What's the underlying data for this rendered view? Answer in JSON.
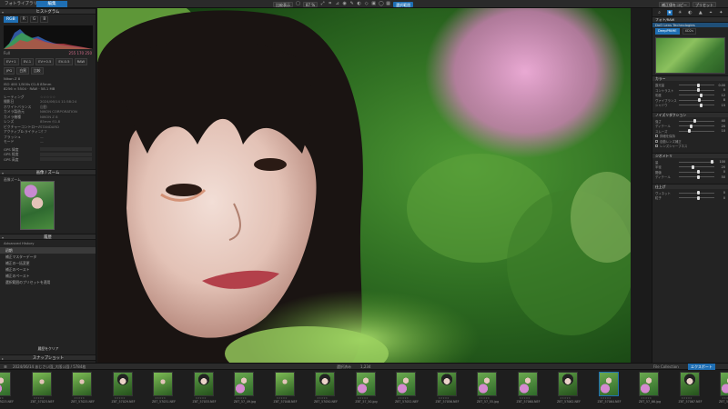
{
  "topbar": {
    "tabs": [
      "フォトライブラリ",
      "編集"
    ],
    "center_buttons": [
      "比較表示",
      "87 %",
      "選択範囲"
    ],
    "right_buttons": [
      "補正値をコピー",
      "プリセット"
    ]
  },
  "left_panel": {
    "histogram": {
      "title": "ヒストグラム",
      "tabs": [
        "RGB",
        "R",
        "G",
        "B"
      ],
      "values": "255  170  250",
      "mode": "Full"
    },
    "ev_buttons": [
      "EV+1",
      "EV-1",
      "EV+0.5",
      "EV-0.5",
      "RAW",
      "JPG",
      "白黒",
      "比較"
    ],
    "info_lines": [
      "Nikon Z 8",
      "ISO 400  1/500s  f/1.8  85mm",
      "8256 × 5504  ·  RAW  ·  58.1 MB"
    ],
    "meta_rows": [
      {
        "k": "レーティング",
        "v": "☆☆☆☆☆"
      },
      {
        "k": "撮影日",
        "v": "2024/06/14  11:58:24"
      },
      {
        "k": "ホワイトバランス",
        "v": "自動"
      },
      {
        "k": "カメラ製造元",
        "v": "NIKON CORPORATION"
      },
      {
        "k": "カメラ機種",
        "v": "NIKON Z 8"
      },
      {
        "k": "レンズ",
        "v": "85mm f/1.8"
      },
      {
        "k": "ピクチャーコントロール",
        "v": "STANDARD"
      },
      {
        "k": "アクティブD-ライティング",
        "v": "オフ"
      },
      {
        "k": "フラッシュ",
        "v": "—"
      },
      {
        "k": "モード",
        "v": "—"
      }
    ],
    "gps_rows": [
      {
        "k": "GPS 緯度",
        "v": ""
      },
      {
        "k": "GPS 経度",
        "v": ""
      },
      {
        "k": "GPS 高度",
        "v": ""
      }
    ],
    "nav_title": "画像 / ズーム",
    "nav_label": "画像ズーム",
    "history": {
      "title": "履歴",
      "sub": "Advanced History",
      "items": [
        "初期",
        "補正マスターデータ",
        "補正の一括変更",
        "補正のペースト",
        "補正のペースト",
        "選択範囲のプリセットを適用"
      ]
    },
    "snapshot_button": "履歴をクリア",
    "bottom_header": "スナップショット"
  },
  "right_panel": {
    "mode_header": "フォト/RAW",
    "lens_header": "DxO Lens Technologies",
    "lens_tabs": [
      "DeepPRIME",
      "XD2s"
    ],
    "sections": [
      {
        "title": "カラー",
        "sliders": [
          {
            "label": "露光量",
            "value": "0.00",
            "pos": 0.5
          },
          {
            "label": "コントラスト",
            "value": "0",
            "pos": 0.5
          },
          {
            "label": "彩度",
            "value": "12",
            "pos": 0.58
          },
          {
            "label": "ヴァイブランス",
            "value": "8",
            "pos": 0.55
          },
          {
            "label": "シャドウ",
            "value": "15",
            "pos": 0.6
          }
        ]
      },
      {
        "title": "ノイズリダクション",
        "sliders": [
          {
            "label": "強さ",
            "value": "40",
            "pos": 0.4
          },
          {
            "label": "ディテール",
            "value": "20",
            "pos": 0.3
          },
          {
            "label": "スムーズ",
            "value": "10",
            "pos": 0.25
          }
        ],
        "checks": [
          "詳細を保持",
          "自動レンズ補正",
          "レンズシャープネス"
        ]
      },
      {
        "title": "ジオメトリ",
        "sliders": [
          {
            "label": "量",
            "value": "100",
            "pos": 0.9
          },
          {
            "label": "半径",
            "value": "20",
            "pos": 0.35
          },
          {
            "label": "閾値",
            "value": "0",
            "pos": 0.5
          },
          {
            "label": "ディテール",
            "value": "50",
            "pos": 0.5
          }
        ]
      },
      {
        "title": "仕上げ",
        "sliders": [
          {
            "label": "ヴィネット",
            "value": "0",
            "pos": 0.5
          },
          {
            "label": "粒子",
            "value": "0",
            "pos": 0.5
          }
        ]
      }
    ]
  },
  "filmbar": {
    "path": "2024/06/14  あじさい園_大阪公園 / 5784枚",
    "count": "1,234",
    "filter": "選択済み",
    "export_label": "エクスポート",
    "collection": "File Collection"
  },
  "filmstrip": [
    {
      "name": "Z8T_57023.NEF",
      "tone": "pink"
    },
    {
      "name": "Z8T_57023.NEF",
      "tone": "green"
    },
    {
      "name": "Z8T_57025.NEF",
      "tone": "green"
    },
    {
      "name": "Z8T_57029.NEF",
      "tone": "portrait"
    },
    {
      "name": "Z8T_57031.NEF",
      "tone": "green"
    },
    {
      "name": "Z8T_57033.NEF",
      "tone": "portrait"
    },
    {
      "name": "Z8T_57_49.jpg",
      "tone": "pink"
    },
    {
      "name": "Z8T_57048.NEF",
      "tone": "green"
    },
    {
      "name": "Z8T_57050.NEF",
      "tone": "portrait"
    },
    {
      "name": "Z8T_57_50.jpg",
      "tone": "pink"
    },
    {
      "name": "Z8T_57052.NEF",
      "tone": "pink"
    },
    {
      "name": "Z8T_57056.NEF",
      "tone": "portrait"
    },
    {
      "name": "Z8T_57_55.jpg",
      "tone": "pink"
    },
    {
      "name": "Z8T_57060.NEF",
      "tone": "pink"
    },
    {
      "name": "Z8T_57062.NEF",
      "tone": "portrait"
    },
    {
      "name": "Z8T_57064.NEF",
      "tone": "pink"
    },
    {
      "name": "Z8T_57_66.jpg",
      "tone": "pink"
    },
    {
      "name": "Z8T_57067.NEF",
      "tone": "portrait"
    },
    {
      "name": "Z8T_57069.NEF",
      "tone": "pink"
    },
    {
      "name": "Z8T_57071.NEF",
      "tone": "pink"
    }
  ],
  "colors": {
    "accent": "#1f6fb4",
    "panel": "#232323",
    "bg": "#1b1b1b"
  }
}
